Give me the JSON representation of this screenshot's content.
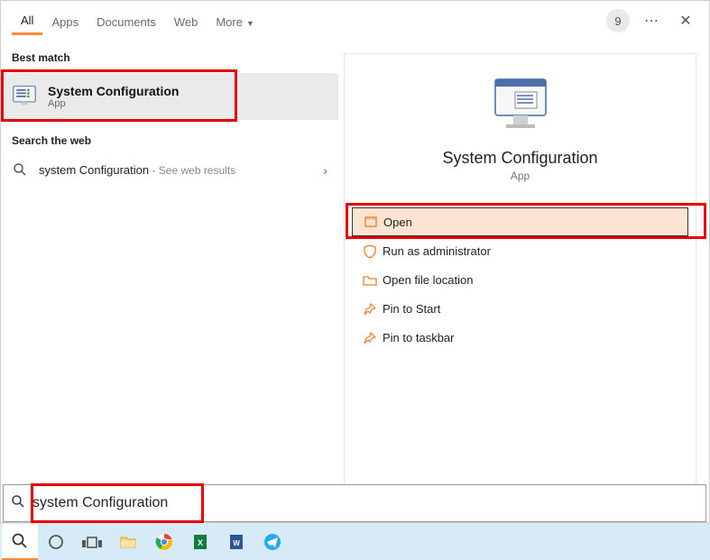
{
  "tabs": {
    "all": "All",
    "apps": "Apps",
    "documents": "Documents",
    "web": "Web",
    "more": "More"
  },
  "badge_number": "9",
  "left": {
    "best_match_label": "Best match",
    "best_match": {
      "title": "System Configuration",
      "subtitle": "App"
    },
    "search_web_label": "Search the web",
    "web_item": {
      "term": "system Configuration",
      "suffix": " - See web results"
    }
  },
  "preview": {
    "title": "System Configuration",
    "subtitle": "App"
  },
  "actions": {
    "open": "Open",
    "run_admin": "Run as administrator",
    "open_loc": "Open file location",
    "pin_start": "Pin to Start",
    "pin_taskbar": "Pin to taskbar"
  },
  "search": {
    "value": "system Configuration"
  }
}
